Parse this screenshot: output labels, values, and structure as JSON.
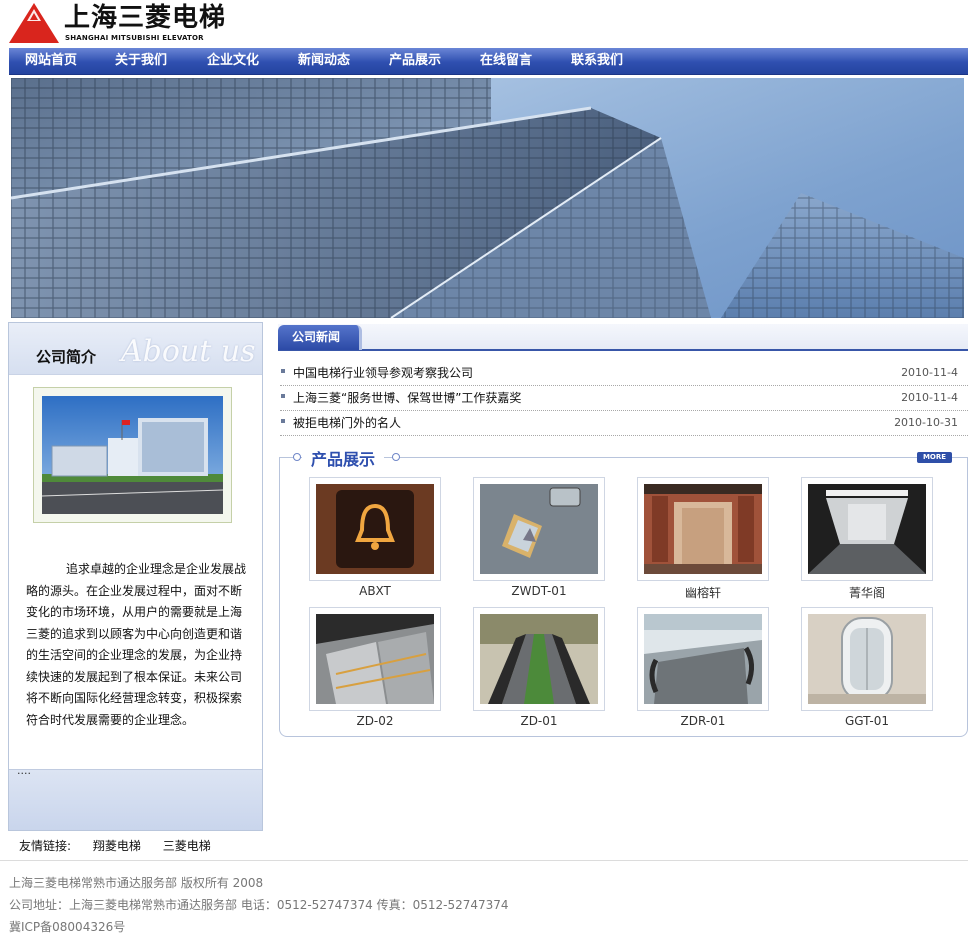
{
  "header": {
    "logo_cn": "上海三菱电梯",
    "logo_en": "SHANGHAI MITSUBISHI ELEVATOR"
  },
  "nav": {
    "items": [
      "网站首页",
      "关于我们",
      "企业文化",
      "新闻动态",
      "产品展示",
      "在线留言",
      "联系我们"
    ]
  },
  "about": {
    "title": "公司简介",
    "deco": "About us",
    "text": "追求卓越的企业理念是企业发展战略的源头。在企业发展过程中，面对不断变化的市场环境，从用户的需要就是上海三菱的追求到以顾客为中心向创造更和谐的生活空间的企业理念的发展，为企业持续快速的发展起到了根本保证。未来公司将不断向国际化经营理念转变，积极探索符合时代发展需要的企业理念。",
    "more": "...."
  },
  "news": {
    "tab": "公司新闻",
    "items": [
      {
        "title": "中国电梯行业领导参观考察我公司",
        "date": "2010-11-4"
      },
      {
        "title": "上海三菱“服务世博、保驾世博”工作获嘉奖",
        "date": "2010-11-4"
      },
      {
        "title": "被拒电梯门外的名人",
        "date": "2010-10-31"
      }
    ]
  },
  "products": {
    "title": "产品展示",
    "more": "MORE",
    "items": [
      {
        "label": "ABXT"
      },
      {
        "label": "ZWDT-01"
      },
      {
        "label": "幽榕轩"
      },
      {
        "label": "菁华阁"
      },
      {
        "label": "ZD-02"
      },
      {
        "label": "ZD-01"
      },
      {
        "label": "ZDR-01"
      },
      {
        "label": "GGT-01"
      }
    ]
  },
  "links": {
    "label": "友情链接:",
    "items": [
      "翔菱电梯",
      "三菱电梯"
    ]
  },
  "footer": {
    "line1": "上海三菱电梯常熟市通达服务部  版权所有  2008",
    "line2": "公司地址：上海三菱电梯常熟市通达服务部      电话：0512-52747374   传真：0512-52747374",
    "line3": "冀ICP备08004326号"
  },
  "colors": {
    "nav_blue": "#2f4fb0",
    "accent_blue": "#2e4fae"
  }
}
